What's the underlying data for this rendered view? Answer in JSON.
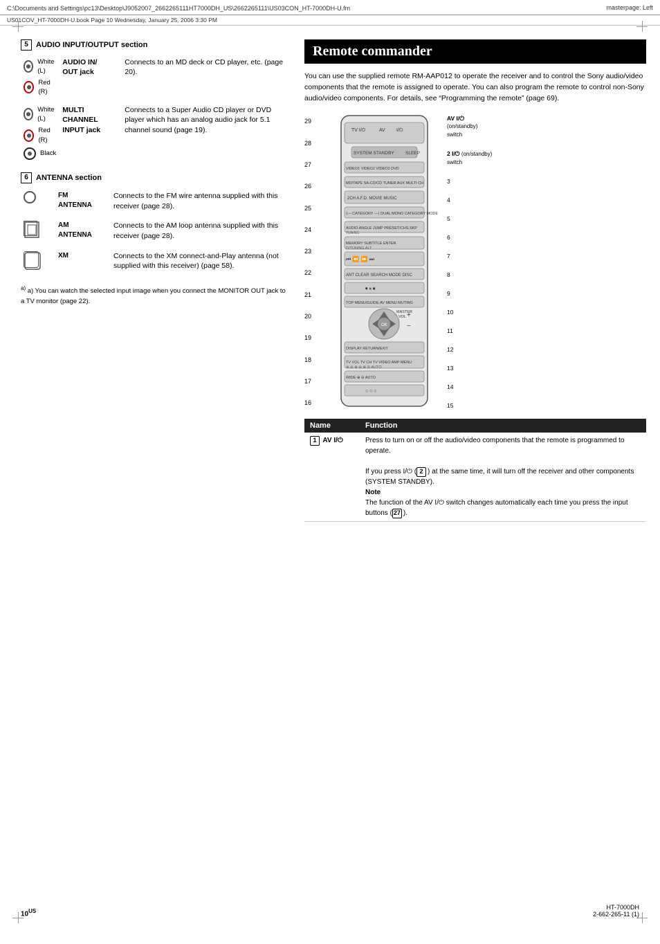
{
  "header": {
    "path": "C:\\Documents and Settings\\pc13\\Desktop\\J9052007_2662265111HT7000DH_US\\2662265111\\US03CON_HT-7000DH-U.fm",
    "masterpage": "masterpage: Left",
    "book_line": "US01COV_HT-7000DH-U.book  Page 10  Wednesday, January 25, 2006  3:30 PM"
  },
  "page_number": "10",
  "page_number_sup": "US",
  "bottom_right": "HT-7000DH\n2-662-265-11 (1)",
  "left": {
    "audio_section": {
      "number": "5",
      "title": "AUDIO INPUT/OUTPUT section",
      "rows": [
        {
          "icons": [
            "White (L)",
            "Red (R)"
          ],
          "label": "AUDIO IN/OUT jack",
          "description": "Connects to an MD deck or CD player, etc. (page 20)."
        },
        {
          "icons": [
            "White (L)",
            "Red (R)",
            "Black"
          ],
          "label": "MULTI CHANNEL INPUT jack",
          "description": "Connects to a Super Audio CD player or DVD player which has an analog audio jack for 5.1 channel sound (page 19)."
        }
      ]
    },
    "antenna_section": {
      "number": "6",
      "title": "ANTENNA section",
      "rows": [
        {
          "icon_type": "circle",
          "label": "FM ANTENNA",
          "description": "Connects to the FM wire antenna supplied with this receiver (page 28)."
        },
        {
          "icon_type": "square",
          "label": "AM ANTENNA",
          "description": "Connects to the AM loop antenna supplied with this receiver (page 28)."
        },
        {
          "icon_type": "rounded",
          "label": "XM",
          "description": "Connects to the XM connect-and-Play antenna (not supplied with this receiver) (page 58)."
        }
      ]
    },
    "footer_note": "a) You can watch the selected input image when you connect the MONITOR OUT jack to a TV monitor (page 22)."
  },
  "right": {
    "title": "Remote commander",
    "intro": "You can use the supplied remote RM-AAP012 to operate the receiver and to control the Sony audio/video components that the remote is assigned to operate. You can also program the remote to control non-Sony audio/video components. For details, see “Programming the remote” (page 69).",
    "name_function_header": [
      "Name",
      "Function"
    ],
    "name_function_rows": [
      {
        "number": "1",
        "name": "AV I/⏻",
        "function_parts": [
          "Press to turn on or off the audio/video components that the remote is programmed to operate.",
          "If you press I/⏻ (",
          "2",
          ") at the same time, it will turn off the receiver and other components (SYSTEM STANDBY).",
          "Note",
          "The function of the AV I/⏻ switch changes automatically each time you press the input buttons (",
          "27",
          ")."
        ]
      }
    ]
  }
}
